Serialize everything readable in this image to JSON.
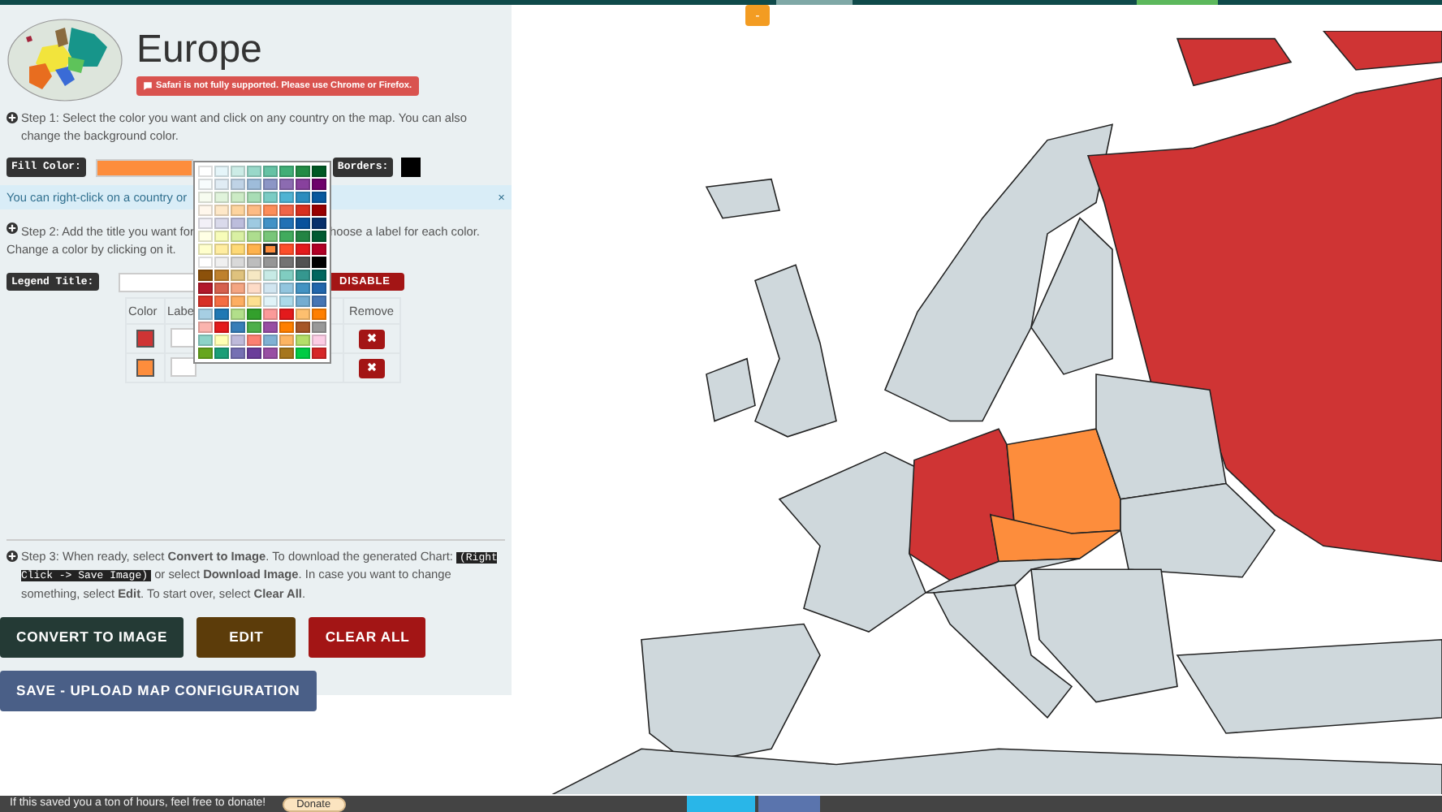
{
  "header": {
    "title": "Europe",
    "warning": "Safari is not fully supported. Please use Chrome or Firefox."
  },
  "step1": {
    "text": "Step 1: Select the color you want and click on any country on the map. You can also change the background color.",
    "fill_label": "Fill Color:",
    "borders_label": "Borders:"
  },
  "alert": {
    "text": "You can right-click on a country or",
    "close": "×"
  },
  "step2": {
    "text_left": "Step 2: Add the title you want for",
    "text_right": "hoose a label for each color.",
    "text_line2": "Change a color by clicking on it.",
    "legend_title_label": "Legend Title:",
    "disable_button": "DISABLE"
  },
  "legend_table": {
    "columns": [
      "Color",
      "Labe",
      "Remove"
    ],
    "rows": [
      {
        "color": "#cf3434"
      },
      {
        "color": "#fd8d3c"
      }
    ]
  },
  "palette": [
    {
      "swatches": [
        {
          "color": "#ffffff",
          "selected": false
        },
        {
          "color": "#e5f5f9",
          "selected": false
        },
        {
          "color": "#ccece6",
          "selected": false
        },
        {
          "color": "#99d8c9",
          "selected": false
        },
        {
          "color": "#66c2a4",
          "selected": false
        },
        {
          "color": "#41ae76",
          "selected": false
        },
        {
          "color": "#238b45",
          "selected": false
        },
        {
          "color": "#005824",
          "selected": false
        }
      ]
    },
    {
      "swatches": [
        {
          "color": "#f7fcfd",
          "selected": false
        },
        {
          "color": "#e0ecf4",
          "selected": false
        },
        {
          "color": "#bfd3e6",
          "selected": false
        },
        {
          "color": "#9ebcda",
          "selected": false
        },
        {
          "color": "#8c96c6",
          "selected": false
        },
        {
          "color": "#8c6bb1",
          "selected": false
        },
        {
          "color": "#88419d",
          "selected": false
        },
        {
          "color": "#6e016b",
          "selected": false
        }
      ]
    },
    {
      "swatches": [
        {
          "color": "#f7fcf0",
          "selected": false
        },
        {
          "color": "#e0f3db",
          "selected": false
        },
        {
          "color": "#ccebc5",
          "selected": false
        },
        {
          "color": "#a8ddb5",
          "selected": false
        },
        {
          "color": "#7bccc4",
          "selected": false
        },
        {
          "color": "#4eb3d3",
          "selected": false
        },
        {
          "color": "#2b8cbe",
          "selected": false
        },
        {
          "color": "#08589e",
          "selected": false
        }
      ]
    },
    {
      "swatches": [
        {
          "color": "#fff7ec",
          "selected": false
        },
        {
          "color": "#fee8c8",
          "selected": false
        },
        {
          "color": "#fdd49e",
          "selected": false
        },
        {
          "color": "#fdbb84",
          "selected": false
        },
        {
          "color": "#fc8d59",
          "selected": false
        },
        {
          "color": "#ef6548",
          "selected": false
        },
        {
          "color": "#d7301f",
          "selected": false
        },
        {
          "color": "#990000",
          "selected": false
        }
      ]
    },
    {
      "swatches": [
        {
          "color": "#f2f0f7",
          "selected": false
        },
        {
          "color": "#dadaeb",
          "selected": false
        },
        {
          "color": "#bcbddc",
          "selected": false
        },
        {
          "color": "#9ecae1",
          "selected": false
        },
        {
          "color": "#4292c6",
          "selected": false
        },
        {
          "color": "#2171b5",
          "selected": false
        },
        {
          "color": "#08519c",
          "selected": false
        },
        {
          "color": "#08306b",
          "selected": false
        }
      ]
    },
    {
      "swatches": [
        {
          "color": "#ffffe5",
          "selected": false
        },
        {
          "color": "#f7fcb9",
          "selected": false
        },
        {
          "color": "#d9f0a3",
          "selected": false
        },
        {
          "color": "#addd8e",
          "selected": false
        },
        {
          "color": "#78c679",
          "selected": false
        },
        {
          "color": "#41ab5d",
          "selected": false
        },
        {
          "color": "#238443",
          "selected": false
        },
        {
          "color": "#005a32",
          "selected": false
        }
      ]
    },
    {
      "swatches": [
        {
          "color": "#ffffcc",
          "selected": false
        },
        {
          "color": "#ffeda0",
          "selected": false
        },
        {
          "color": "#fed976",
          "selected": false
        },
        {
          "color": "#feb24c",
          "selected": false
        },
        {
          "color": "#fd8d3c",
          "selected": true
        },
        {
          "color": "#fc4e2a",
          "selected": false
        },
        {
          "color": "#e31a1c",
          "selected": false
        },
        {
          "color": "#b10026",
          "selected": false
        }
      ]
    },
    {
      "swatches": [
        {
          "color": "#ffffff",
          "selected": false
        },
        {
          "color": "#f0f0f0",
          "selected": false
        },
        {
          "color": "#d9d9d9",
          "selected": false
        },
        {
          "color": "#bdbdbd",
          "selected": false
        },
        {
          "color": "#969696",
          "selected": false
        },
        {
          "color": "#737373",
          "selected": false
        },
        {
          "color": "#525252",
          "selected": false
        },
        {
          "color": "#000000",
          "selected": false
        }
      ]
    },
    {
      "swatches": [
        {
          "color": "#8c510a",
          "selected": false
        },
        {
          "color": "#bf812d",
          "selected": false
        },
        {
          "color": "#dfc27d",
          "selected": false
        },
        {
          "color": "#f6e8c3",
          "selected": false
        },
        {
          "color": "#c7eae5",
          "selected": false
        },
        {
          "color": "#80cdc1",
          "selected": false
        },
        {
          "color": "#35978f",
          "selected": false
        },
        {
          "color": "#01665e",
          "selected": false
        }
      ]
    },
    {
      "swatches": [
        {
          "color": "#b2182b",
          "selected": false
        },
        {
          "color": "#d6604d",
          "selected": false
        },
        {
          "color": "#f4a582",
          "selected": false
        },
        {
          "color": "#fddbc7",
          "selected": false
        },
        {
          "color": "#d1e5f0",
          "selected": false
        },
        {
          "color": "#92c5de",
          "selected": false
        },
        {
          "color": "#4393c3",
          "selected": false
        },
        {
          "color": "#2166ac",
          "selected": false
        }
      ]
    },
    {
      "swatches": [
        {
          "color": "#d73027",
          "selected": false
        },
        {
          "color": "#f46d43",
          "selected": false
        },
        {
          "color": "#fdae61",
          "selected": false
        },
        {
          "color": "#fee090",
          "selected": false
        },
        {
          "color": "#e0f3f8",
          "selected": false
        },
        {
          "color": "#abd9e9",
          "selected": false
        },
        {
          "color": "#74add1",
          "selected": false
        },
        {
          "color": "#4575b4",
          "selected": false
        }
      ]
    },
    {
      "swatches": [
        {
          "color": "#a6cee3",
          "selected": false
        },
        {
          "color": "#1f78b4",
          "selected": false
        },
        {
          "color": "#b2df8a",
          "selected": false
        },
        {
          "color": "#33a02c",
          "selected": false
        },
        {
          "color": "#fb9a99",
          "selected": false
        },
        {
          "color": "#e31a1c",
          "selected": false
        },
        {
          "color": "#fdbf6f",
          "selected": false
        },
        {
          "color": "#ff7f00",
          "selected": false
        }
      ]
    },
    {
      "swatches": [
        {
          "color": "#fbb4ae",
          "selected": false
        },
        {
          "color": "#e41a1c",
          "selected": false
        },
        {
          "color": "#377eb8",
          "selected": false
        },
        {
          "color": "#4daf4a",
          "selected": false
        },
        {
          "color": "#984ea3",
          "selected": false
        },
        {
          "color": "#ff7f00",
          "selected": false
        },
        {
          "color": "#a65628",
          "selected": false
        },
        {
          "color": "#999999",
          "selected": false
        }
      ]
    },
    {
      "swatches": [
        {
          "color": "#8dd3c7",
          "selected": false
        },
        {
          "color": "#ffffb3",
          "selected": false
        },
        {
          "color": "#bebada",
          "selected": false
        },
        {
          "color": "#fb8072",
          "selected": false
        },
        {
          "color": "#80b1d3",
          "selected": false
        },
        {
          "color": "#fdb462",
          "selected": false
        },
        {
          "color": "#b3de69",
          "selected": false
        },
        {
          "color": "#fccde5",
          "selected": false
        }
      ]
    },
    {
      "swatches": [
        {
          "color": "#66a61e",
          "selected": false
        },
        {
          "color": "#1b9e77",
          "selected": false
        },
        {
          "color": "#7570b3",
          "selected": false
        },
        {
          "color": "#6a3d9a",
          "selected": false
        },
        {
          "color": "#984ea3",
          "selected": false
        },
        {
          "color": "#a6761d",
          "selected": false
        },
        {
          "color": "#00cc44",
          "selected": false
        },
        {
          "color": "#d62728",
          "selected": false
        }
      ]
    }
  ],
  "step3": {
    "segments": [
      {
        "kind": "text",
        "text": "Step 3:  When ready, select **Convert to Image**. To download the generated Chart: "
      },
      {
        "kind": "code",
        "text": "(Right Click -> Save Image)"
      },
      {
        "kind": "text",
        "text": " or select **Download Image**. In case you want to change something, select **Edit**. To start over, select **Clear All**."
      }
    ]
  },
  "buttons": [
    {
      "label": "CONVERT TO IMAGE",
      "kind": "convert"
    },
    {
      "label": "EDIT",
      "kind": "edit"
    },
    {
      "label": "CLEAR ALL",
      "kind": "clear"
    },
    {
      "label": "SAVE - UPLOAD MAP CONFIGURATION",
      "kind": "save"
    }
  ],
  "map_toggle": "-",
  "footer": {
    "text": "If this saved you a ton of hours, feel free to donate!",
    "donate": "Donate"
  }
}
